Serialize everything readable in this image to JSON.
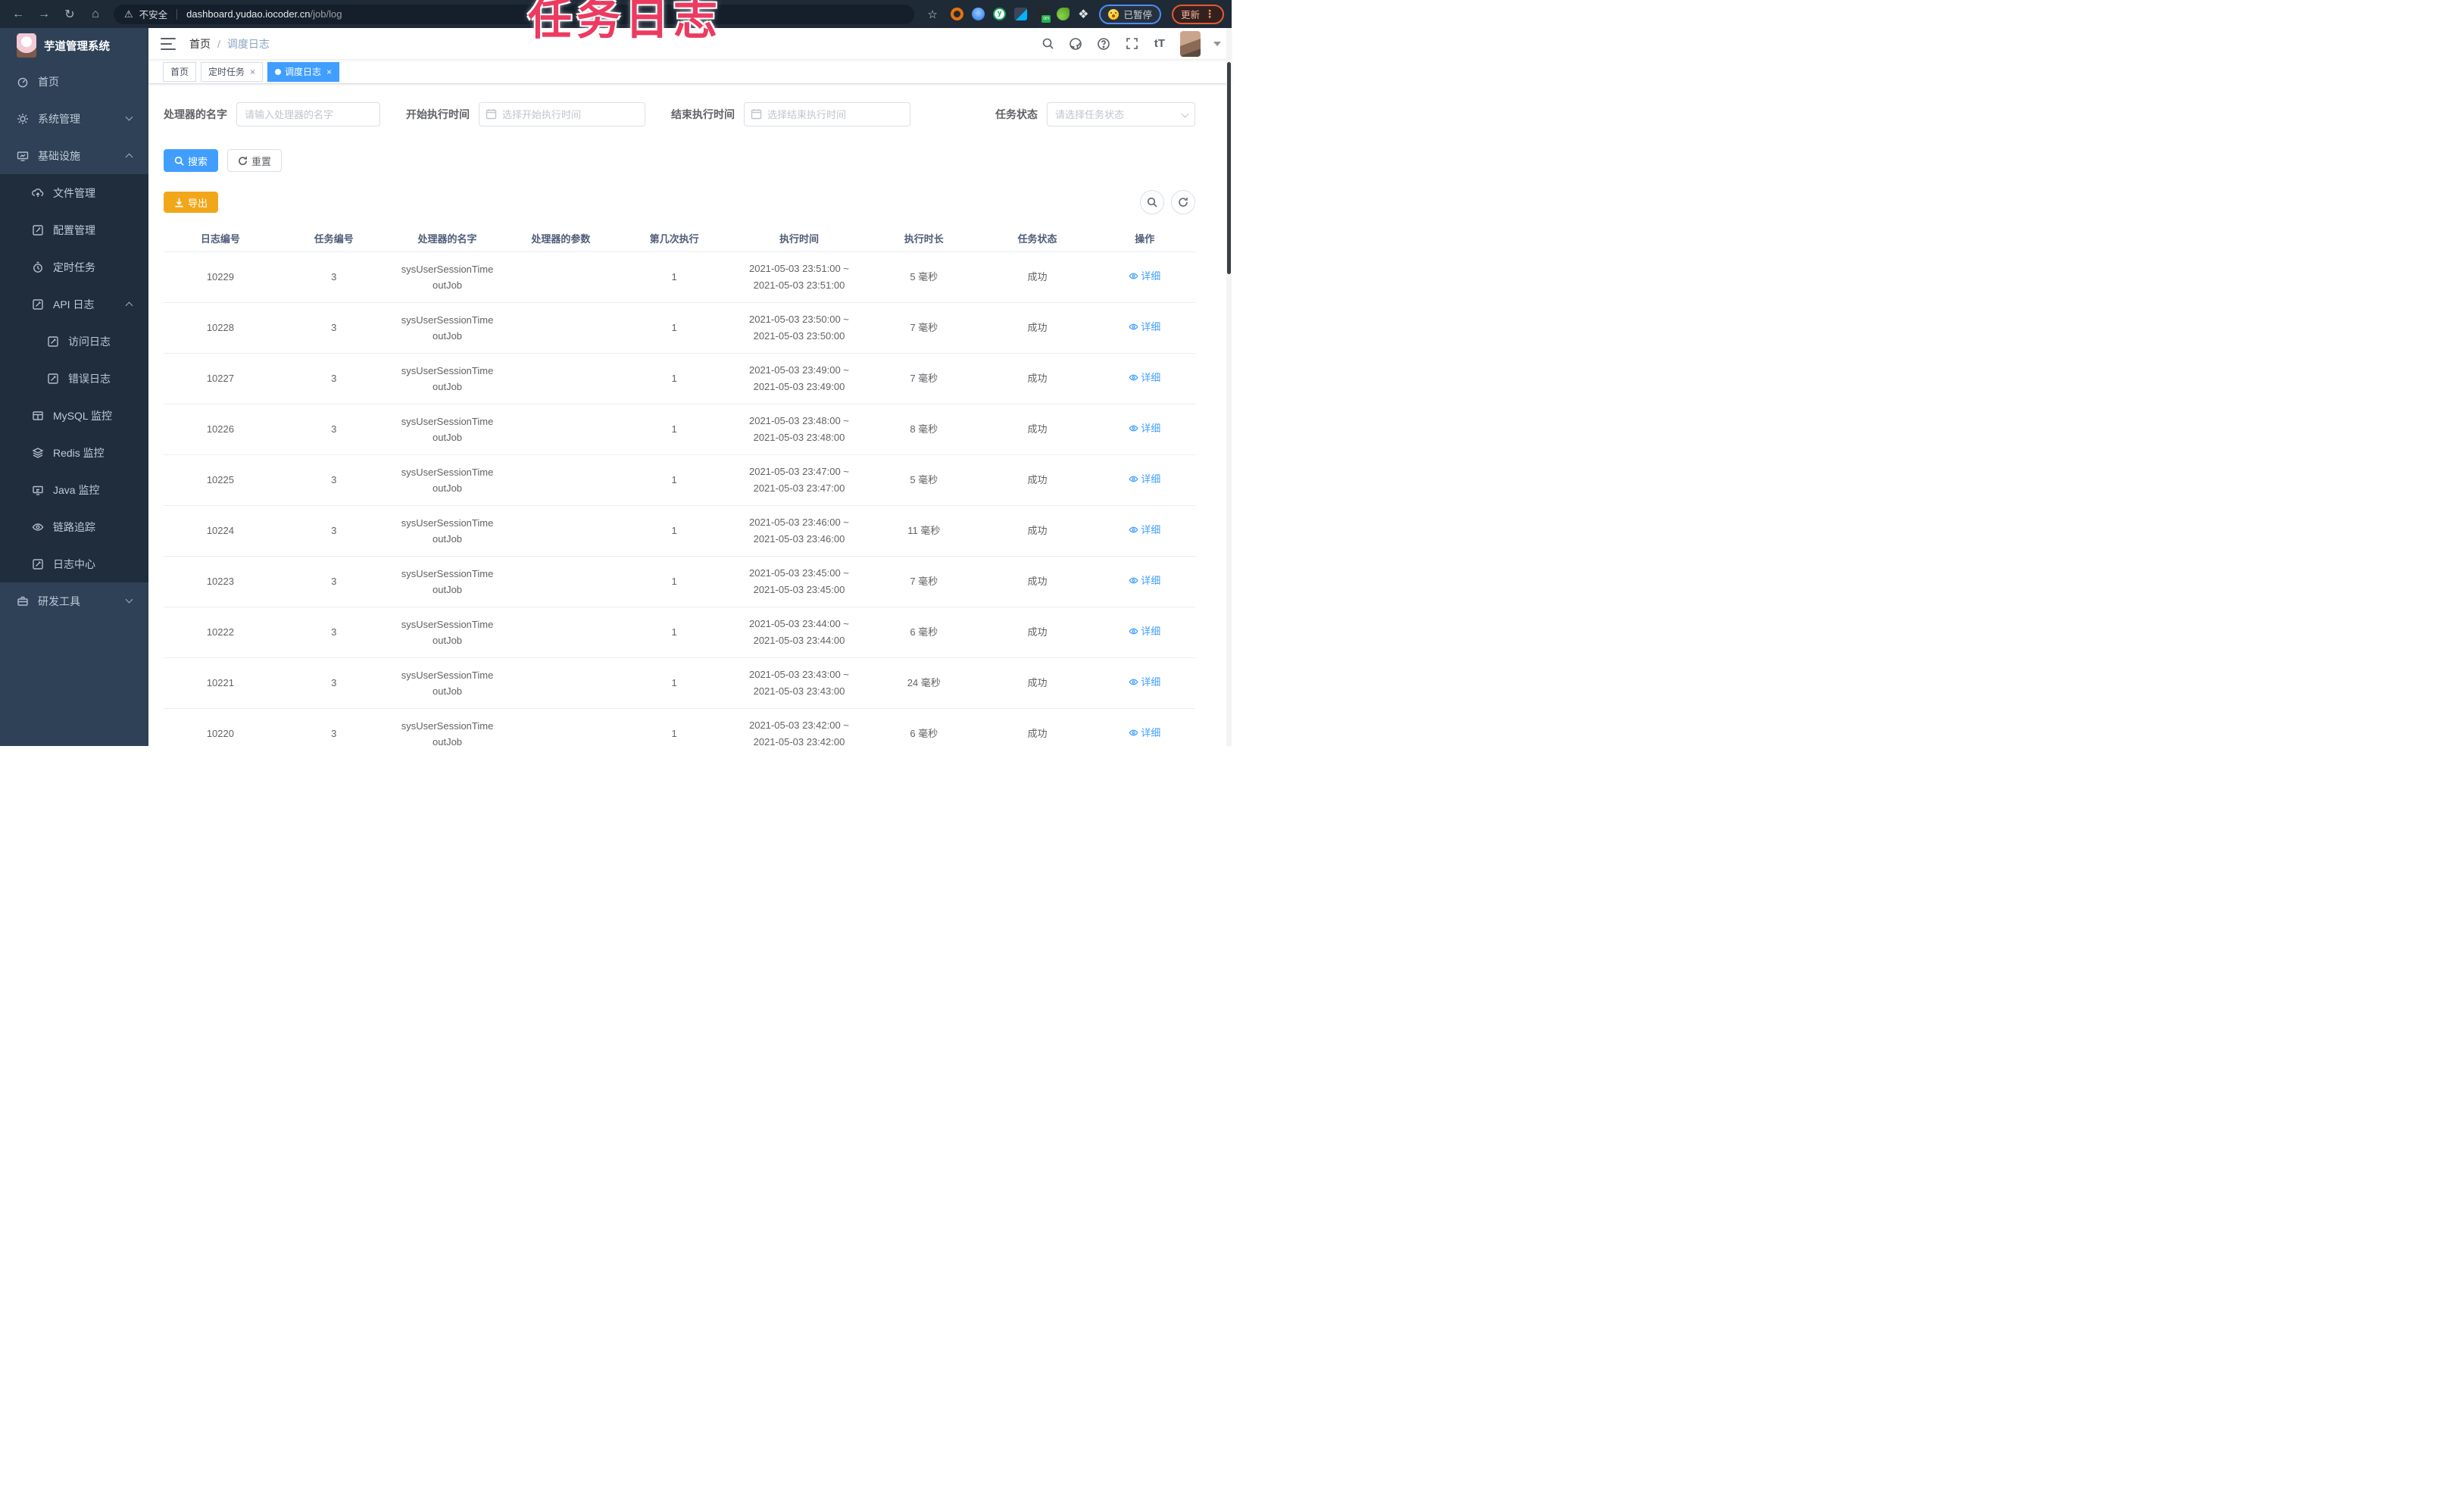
{
  "annotation": {
    "text": "任务日志",
    "color": "#ec3a60"
  },
  "icons": {
    "back": "←",
    "forward": "→",
    "reload": "↻",
    "home": "⌂",
    "warning": "⚠",
    "star": "☆",
    "more": "⋮",
    "close": "×",
    "puzzle": "❖"
  },
  "browser": {
    "security_label": "不安全",
    "url_host": "dashboard.yudao.iocoder.cn",
    "url_path": "/job/log",
    "paused_label": "已暂停",
    "update_label": "更新"
  },
  "sidebar": {
    "logo_title": "芋道管理系统",
    "items": [
      {
        "label": "首页",
        "icon": "dashboard-icon"
      },
      {
        "label": "系统管理",
        "icon": "gear-icon",
        "chevron": "down"
      },
      {
        "label": "基础设施",
        "icon": "monitor-icon",
        "chevron": "up",
        "children": [
          {
            "label": "文件管理",
            "icon": "cloud-upload-icon"
          },
          {
            "label": "配置管理",
            "icon": "edit-icon"
          },
          {
            "label": "定时任务",
            "icon": "timer-icon"
          },
          {
            "label": "API 日志",
            "icon": "log-icon",
            "chevron": "up",
            "children": [
              {
                "label": "访问日志",
                "icon": "log-icon"
              },
              {
                "label": "错误日志",
                "icon": "log-icon"
              }
            ]
          },
          {
            "label": "MySQL 监控",
            "icon": "table-icon"
          },
          {
            "label": "Redis 监控",
            "icon": "layers-icon"
          },
          {
            "label": "Java 监控",
            "icon": "java-icon"
          },
          {
            "label": "链路追踪",
            "icon": "eye-icon"
          },
          {
            "label": "日志中心",
            "icon": "log-icon"
          }
        ]
      },
      {
        "label": "研发工具",
        "icon": "toolbox-icon",
        "chevron": "down"
      }
    ]
  },
  "header": {
    "breadcrumb": [
      "首页",
      "调度日志"
    ],
    "breadcrumb_separator": "/"
  },
  "tabs": [
    {
      "label": "首页",
      "active": false,
      "closable": false
    },
    {
      "label": "定时任务",
      "active": false,
      "closable": true
    },
    {
      "label": "调度日志",
      "active": true,
      "closable": true
    }
  ],
  "filters": {
    "handler": {
      "label": "处理器的名字",
      "placeholder": "请输入处理器的名字"
    },
    "begin_time": {
      "label": "开始执行时间",
      "placeholder": "选择开始执行时间"
    },
    "end_time": {
      "label": "结束执行时间",
      "placeholder": "选择结束执行时间"
    },
    "status": {
      "label": "任务状态",
      "placeholder": "请选择任务状态"
    }
  },
  "actions": {
    "search": "搜索",
    "reset": "重置",
    "export": "导出"
  },
  "table": {
    "headers": [
      "日志编号",
      "任务编号",
      "处理器的名字",
      "处理器的参数",
      "第几次执行",
      "执行时间",
      "执行时长",
      "任务状态",
      "操作"
    ],
    "action_label": "详细",
    "rows": [
      {
        "log_id": "10229",
        "job_id": "3",
        "handler": "sysUserSessionTimeoutJob",
        "param": "",
        "execute_index": "1",
        "execute_time": [
          "2021-05-03 23:51:00 ~",
          "2021-05-03 23:51:00"
        ],
        "duration": "5 毫秒",
        "status": "成功"
      },
      {
        "log_id": "10228",
        "job_id": "3",
        "handler": "sysUserSessionTimeoutJob",
        "param": "",
        "execute_index": "1",
        "execute_time": [
          "2021-05-03 23:50:00 ~",
          "2021-05-03 23:50:00"
        ],
        "duration": "7 毫秒",
        "status": "成功"
      },
      {
        "log_id": "10227",
        "job_id": "3",
        "handler": "sysUserSessionTimeoutJob",
        "param": "",
        "execute_index": "1",
        "execute_time": [
          "2021-05-03 23:49:00 ~",
          "2021-05-03 23:49:00"
        ],
        "duration": "7 毫秒",
        "status": "成功"
      },
      {
        "log_id": "10226",
        "job_id": "3",
        "handler": "sysUserSessionTimeoutJob",
        "param": "",
        "execute_index": "1",
        "execute_time": [
          "2021-05-03 23:48:00 ~",
          "2021-05-03 23:48:00"
        ],
        "duration": "8 毫秒",
        "status": "成功"
      },
      {
        "log_id": "10225",
        "job_id": "3",
        "handler": "sysUserSessionTimeoutJob",
        "param": "",
        "execute_index": "1",
        "execute_time": [
          "2021-05-03 23:47:00 ~",
          "2021-05-03 23:47:00"
        ],
        "duration": "5 毫秒",
        "status": "成功"
      },
      {
        "log_id": "10224",
        "job_id": "3",
        "handler": "sysUserSessionTimeoutJob",
        "param": "",
        "execute_index": "1",
        "execute_time": [
          "2021-05-03 23:46:00 ~",
          "2021-05-03 23:46:00"
        ],
        "duration": "11 毫秒",
        "status": "成功"
      },
      {
        "log_id": "10223",
        "job_id": "3",
        "handler": "sysUserSessionTimeoutJob",
        "param": "",
        "execute_index": "1",
        "execute_time": [
          "2021-05-03 23:45:00 ~",
          "2021-05-03 23:45:00"
        ],
        "duration": "7 毫秒",
        "status": "成功"
      },
      {
        "log_id": "10222",
        "job_id": "3",
        "handler": "sysUserSessionTimeoutJob",
        "param": "",
        "execute_index": "1",
        "execute_time": [
          "2021-05-03 23:44:00 ~",
          "2021-05-03 23:44:00"
        ],
        "duration": "6 毫秒",
        "status": "成功"
      },
      {
        "log_id": "10221",
        "job_id": "3",
        "handler": "sysUserSessionTimeoutJob",
        "param": "",
        "execute_index": "1",
        "execute_time": [
          "2021-05-03 23:43:00 ~",
          "2021-05-03 23:43:00"
        ],
        "duration": "24 毫秒",
        "status": "成功"
      },
      {
        "log_id": "10220",
        "job_id": "3",
        "handler": "sysUserSessionTimeoutJob",
        "param": "",
        "execute_index": "1",
        "execute_time": [
          "2021-05-03 23:42:00 ~",
          "2021-05-03 23:42:00"
        ],
        "duration": "6 毫秒",
        "status": "成功"
      }
    ]
  }
}
